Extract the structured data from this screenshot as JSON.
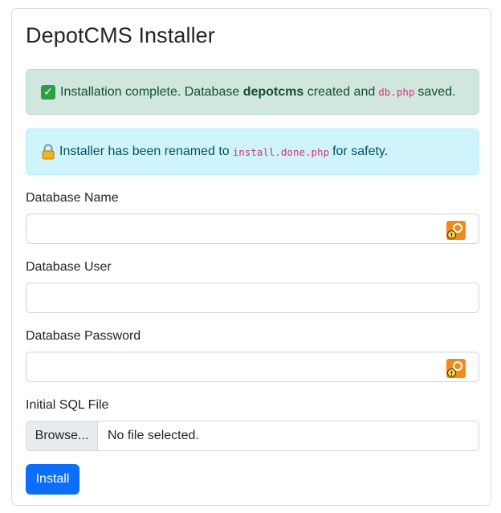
{
  "title": "DepotCMS Installer",
  "alerts": {
    "success": {
      "pre": "Installation complete. Database",
      "db_name": "depotcms",
      "mid": "created and",
      "file": "db.php",
      "post": "saved."
    },
    "info": {
      "pre": "Installer has been renamed to",
      "file": "install.done.php",
      "post": "for safety."
    }
  },
  "form": {
    "db_name_label": "Database Name",
    "db_name_value": "",
    "db_user_label": "Database User",
    "db_user_value": "",
    "db_password_label": "Database Password",
    "db_password_value": "",
    "sql_file_label": "Initial SQL File",
    "browse_label": "Browse...",
    "no_file_text": "No file selected.",
    "submit_label": "Install"
  },
  "colors": {
    "primary": "#0d6efd",
    "success_bg": "#d1e7dd",
    "info_bg": "#cff4fc",
    "code": "#d63384"
  },
  "icons": {
    "success": "check-mark-icon",
    "info": "lock-icon",
    "password_manager": "key-warning-icon"
  }
}
